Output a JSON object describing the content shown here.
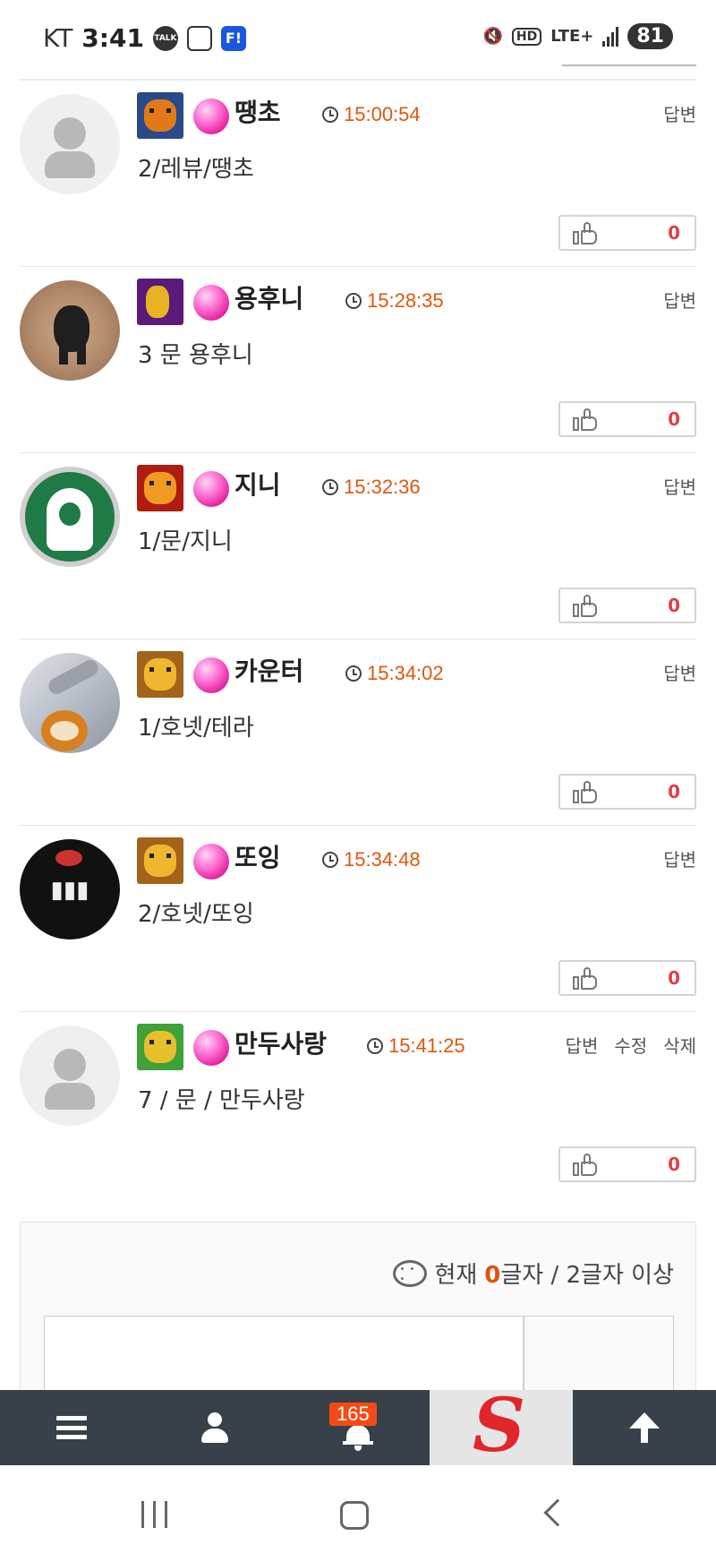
{
  "status_bar": {
    "carrier": "KT",
    "time": "3:41",
    "talk_label": "TALK",
    "f_label": "F!",
    "hd_label": "HD",
    "lte_label": "LTE+",
    "battery": "81"
  },
  "comments": [
    {
      "name": "땡초",
      "time": "15:00:54",
      "text": "2/레뷰/땡초",
      "likes": "0",
      "actions": [
        "답변"
      ]
    },
    {
      "name": "용후니",
      "time": "15:28:35",
      "text": "3 문 용후니",
      "likes": "0",
      "actions": [
        "답변"
      ]
    },
    {
      "name": "지니",
      "time": "15:32:36",
      "text": "1/문/지니",
      "likes": "0",
      "actions": [
        "답변"
      ]
    },
    {
      "name": "카운터",
      "time": "15:34:02",
      "text": "1/호넷/테라",
      "likes": "0",
      "actions": [
        "답변"
      ]
    },
    {
      "name": "또잉",
      "time": "15:34:48",
      "text": "2/호넷/또잉",
      "likes": "0",
      "actions": [
        "답변"
      ]
    },
    {
      "name": "만두사랑",
      "time": "15:41:25",
      "text": "7 / 문 / 만두사랑",
      "likes": "0",
      "actions": [
        "답변",
        "수정",
        "삭제"
      ]
    }
  ],
  "editor": {
    "count_prefix": "현재",
    "count_value": "0",
    "count_suffix": "글자 / 2글자 이상"
  },
  "bottom_nav": {
    "notification_count": "165",
    "logo_letter": "S",
    "brand_color": "#e0262a",
    "badge_color": "#f44b16"
  },
  "colors": {
    "time_color": "#e0560d",
    "like_count_color": "#e0404a",
    "nav_bg": "#38404a"
  }
}
